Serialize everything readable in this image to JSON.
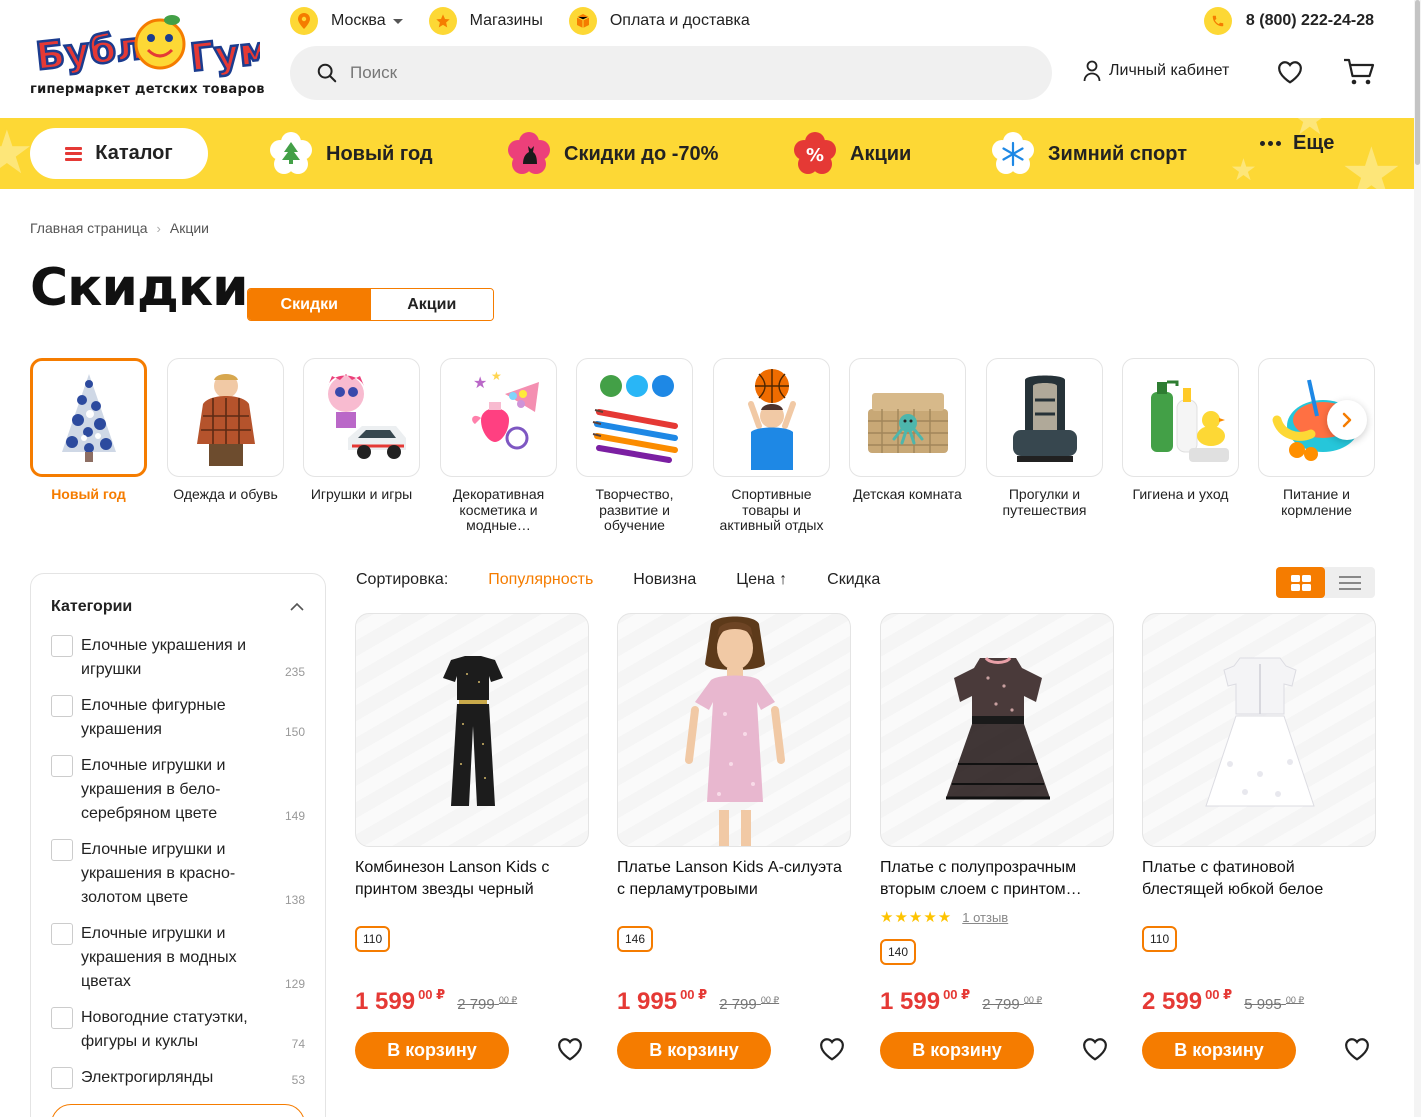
{
  "header": {
    "logo_text": "Бубль Гум",
    "logo_tagline": "гипермаркет детских товаров",
    "city": "Москва",
    "stores": "Магазины",
    "delivery": "Оплата и доставка",
    "phone": "8 (800) 222-24-28",
    "search_placeholder": "Поиск",
    "account": "Личный кабинет"
  },
  "nav": {
    "catalog": "Каталог",
    "items": [
      {
        "label": "Новый год",
        "icon": "tree-icon"
      },
      {
        "label": "Скидки до -70%",
        "icon": "cat-icon"
      },
      {
        "label": "Акции",
        "icon": "percent-icon"
      },
      {
        "label": "Зимний спорт",
        "icon": "snowflake-icon"
      },
      {
        "label": "Еще",
        "icon": "dots-icon"
      }
    ]
  },
  "breadcrumb": [
    "Главная страница",
    "Акции"
  ],
  "page_title": "Скидки",
  "toggle": {
    "active": "Скидки",
    "inactive": "Акции"
  },
  "categories": [
    {
      "label": "Новый год",
      "active": true
    },
    {
      "label": "Одежда и обувь"
    },
    {
      "label": "Игрушки и игры"
    },
    {
      "label": "Декоративная косметика и модные…"
    },
    {
      "label": "Творчество, развитие и обучение"
    },
    {
      "label": "Спортивные товары и активный отдых"
    },
    {
      "label": "Детская комната"
    },
    {
      "label": "Прогулки и путешествия"
    },
    {
      "label": "Гигиена и уход"
    },
    {
      "label": "Питание и кормление"
    }
  ],
  "sidebar": {
    "title": "Категории",
    "items": [
      {
        "label": "Елочные украшения и игрушки",
        "count": "235"
      },
      {
        "label": "Елочные фигурные украшения",
        "count": "150"
      },
      {
        "label": "Елочные игрушки и украшения в бело-серебряном цвете",
        "count": "149"
      },
      {
        "label": "Елочные игрушки и украшения в красно-золотом цвете",
        "count": "138"
      },
      {
        "label": "Елочные игрушки и украшения в модных цветах",
        "count": "129"
      },
      {
        "label": "Новогодние статуэтки, фигуры и куклы",
        "count": "74"
      },
      {
        "label": "Электрогирлянды",
        "count": "53"
      }
    ]
  },
  "sort": {
    "label": "Сортировка:",
    "options": [
      "Популярность",
      "Новизна",
      "Цена",
      "Скидка"
    ],
    "active": "Популярность"
  },
  "products": [
    {
      "name": "Комбинезон Lanson Kids с принтом звезды черный",
      "size": "110",
      "price": "1 599",
      "price_kop": "00 ₽",
      "old_price": "2 799",
      "old_kop": "00 ₽",
      "rating": null,
      "reviews": null,
      "buy": "В корзину"
    },
    {
      "name": "Платье Lanson Kids А-силуэта с перламутровыми пайетками…",
      "size": "146",
      "price": "1 995",
      "price_kop": "00 ₽",
      "old_price": "2 799",
      "old_kop": "00 ₽",
      "rating": null,
      "reviews": null,
      "buy": "В корзину"
    },
    {
      "name": "Платье с полупрозрачным вторым слоем с принтом…",
      "size": "140",
      "price": "1 599",
      "price_kop": "00 ₽",
      "old_price": "2 799",
      "old_kop": "00 ₽",
      "rating": 5,
      "reviews": "1 отзыв",
      "buy": "В корзину"
    },
    {
      "name": "Платье с фатиновой блестящей юбкой белое",
      "size": "110",
      "price": "2 599",
      "price_kop": "00 ₽",
      "old_price": "5 995",
      "old_kop": "00 ₽",
      "rating": null,
      "reviews": null,
      "buy": "В корзину"
    }
  ],
  "colors": {
    "accent": "#f57c00",
    "nav_yellow": "#fdd835",
    "price_red": "#e53935"
  }
}
